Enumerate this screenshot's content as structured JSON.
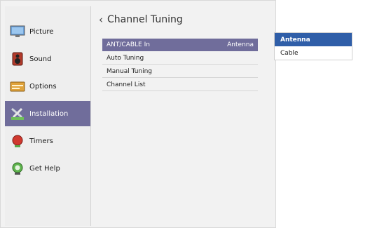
{
  "sidebar": {
    "items": [
      {
        "label": "Picture",
        "icon": "picture-icon",
        "active": false
      },
      {
        "label": "Sound",
        "icon": "speaker-icon",
        "active": false
      },
      {
        "label": "Options",
        "icon": "options-icon",
        "active": false
      },
      {
        "label": "Installation",
        "icon": "tools-icon",
        "active": true
      },
      {
        "label": "Timers",
        "icon": "timer-icon",
        "active": false
      },
      {
        "label": "Get Help",
        "icon": "help-icon",
        "active": false
      }
    ]
  },
  "panel": {
    "title": "Channel Tuning",
    "rows": [
      {
        "label": "ANT/CABLE In",
        "value": "Antenna",
        "selected": true
      },
      {
        "label": "Auto Tuning",
        "value": "",
        "selected": false
      },
      {
        "label": "Manual Tuning",
        "value": "",
        "selected": false
      },
      {
        "label": "Channel List",
        "value": "",
        "selected": false
      }
    ]
  },
  "dropdown": {
    "options": [
      "Antenna",
      "Cable"
    ],
    "selected": "Antenna"
  },
  "colors": {
    "highlight": "#706d9b",
    "dropdown_selected": "#2f5ea8",
    "background": "#f2f2f2"
  }
}
